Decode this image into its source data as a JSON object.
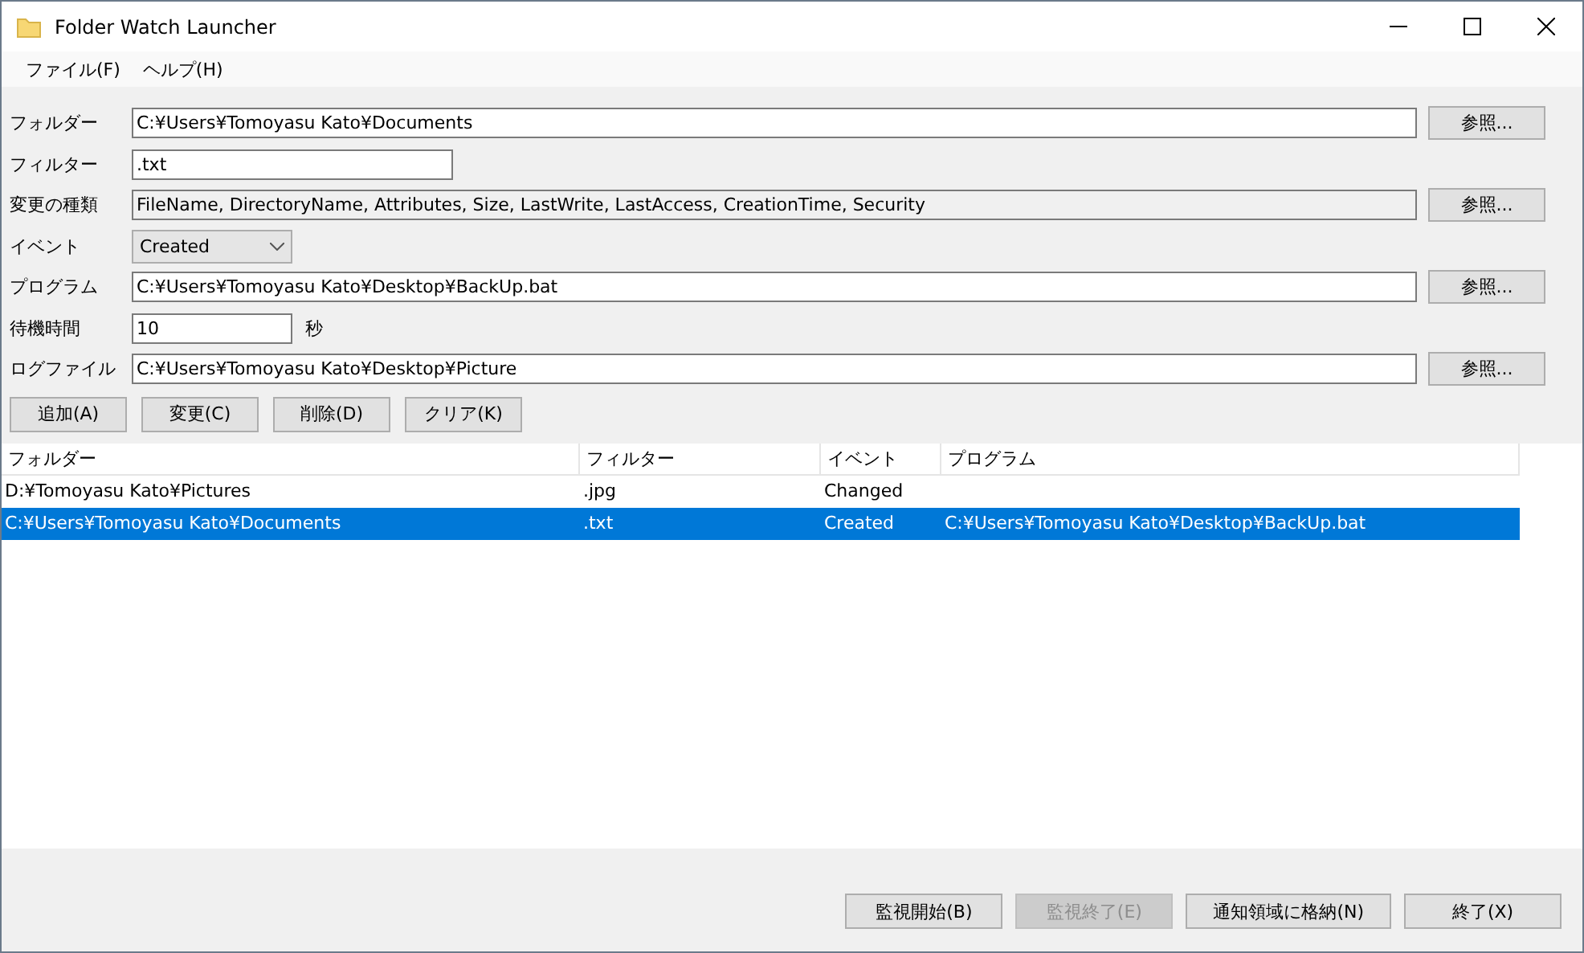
{
  "window": {
    "title": "Folder Watch Launcher"
  },
  "menu": [
    "ファイル(F)",
    "ヘルプ(H)"
  ],
  "form": [
    {
      "kind": "path",
      "label": "フォルダー",
      "value": "C:¥Users¥Tomoyasu Kato¥Documents",
      "browse": "参照..."
    },
    {
      "kind": "short",
      "label": "フィルター",
      "value": ".txt"
    },
    {
      "kind": "readonly",
      "label": "変更の種類",
      "value": "FileName, DirectoryName, Attributes, Size, LastWrite, LastAccess, CreationTime, Security",
      "browse": "参照..."
    },
    {
      "kind": "combo",
      "label": "イベント",
      "value": "Created"
    },
    {
      "kind": "path",
      "label": "プログラム",
      "value": "C:¥Users¥Tomoyasu Kato¥Desktop¥BackUp.bat",
      "browse": "参照..."
    },
    {
      "kind": "number",
      "label": "待機時間",
      "value": "10",
      "unit": "秒"
    },
    {
      "kind": "path",
      "label": "ログファイル",
      "value": "C:¥Users¥Tomoyasu Kato¥Desktop¥Picture",
      "browse": "参照..."
    }
  ],
  "actions": [
    "追加(A)",
    "変更(C)",
    "削除(D)",
    "クリア(K)"
  ],
  "table": {
    "columns": [
      "フォルダー",
      "フィルター",
      "イベント",
      "プログラム"
    ],
    "rows": [
      {
        "cells": [
          "D:¥Tomoyasu Kato¥Pictures",
          ".jpg",
          "Changed",
          ""
        ],
        "selected": false
      },
      {
        "cells": [
          "C:¥Users¥Tomoyasu Kato¥Documents",
          ".txt",
          "Created",
          "C:¥Users¥Tomoyasu Kato¥Desktop¥BackUp.bat"
        ],
        "selected": true
      }
    ]
  },
  "footer_buttons": [
    {
      "label": "監視開始(B)",
      "disabled": false
    },
    {
      "label": "監視終了(E)",
      "disabled": true
    },
    {
      "label": "通知領域に格納(N)",
      "disabled": false
    },
    {
      "label": "終了(X)",
      "disabled": false
    }
  ]
}
